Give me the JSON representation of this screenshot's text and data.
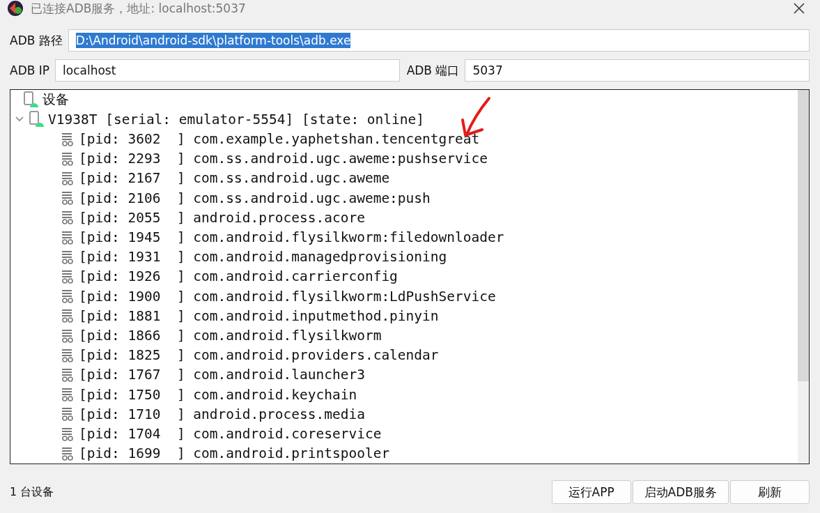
{
  "window": {
    "title": "已连接ADB服务，地址: localhost:5037"
  },
  "adb_path": {
    "label": "ADB 路径",
    "value": "D:\\Android\\android-sdk\\platform-tools\\adb.exe",
    "selected": true
  },
  "adb_ip": {
    "label": "ADB IP",
    "value": "localhost"
  },
  "adb_port": {
    "label": "ADB 端口",
    "value": "5037"
  },
  "tree": {
    "label": "设备",
    "children": [
      {
        "label": "V1938T [serial: emulator-5554] [state: online]",
        "expanded": true,
        "children": [
          {
            "label": "[pid: 3602  ] com.example.yaphetshan.tencentgreat"
          },
          {
            "label": "[pid: 2293  ] com.ss.android.ugc.aweme:pushservice"
          },
          {
            "label": "[pid: 2167  ] com.ss.android.ugc.aweme"
          },
          {
            "label": "[pid: 2106  ] com.ss.android.ugc.aweme:push"
          },
          {
            "label": "[pid: 2055  ] android.process.acore"
          },
          {
            "label": "[pid: 1945  ] com.android.flysilkworm:filedownloader"
          },
          {
            "label": "[pid: 1931  ] com.android.managedprovisioning"
          },
          {
            "label": "[pid: 1926  ] com.android.carrierconfig"
          },
          {
            "label": "[pid: 1900  ] com.android.flysilkworm:LdPushService"
          },
          {
            "label": "[pid: 1881  ] com.android.inputmethod.pinyin"
          },
          {
            "label": "[pid: 1866  ] com.android.flysilkworm"
          },
          {
            "label": "[pid: 1825  ] com.android.providers.calendar"
          },
          {
            "label": "[pid: 1767  ] com.android.launcher3"
          },
          {
            "label": "[pid: 1750  ] com.android.keychain"
          },
          {
            "label": "[pid: 1710  ] android.process.media"
          },
          {
            "label": "[pid: 1704  ] com.android.coreservice"
          },
          {
            "label": "[pid: 1699  ] com.android.printspooler"
          }
        ]
      }
    ]
  },
  "status_bar": {
    "text": "1 台设备"
  },
  "buttons": [
    "运行APP",
    "启动ADB服务",
    "刷新"
  ]
}
